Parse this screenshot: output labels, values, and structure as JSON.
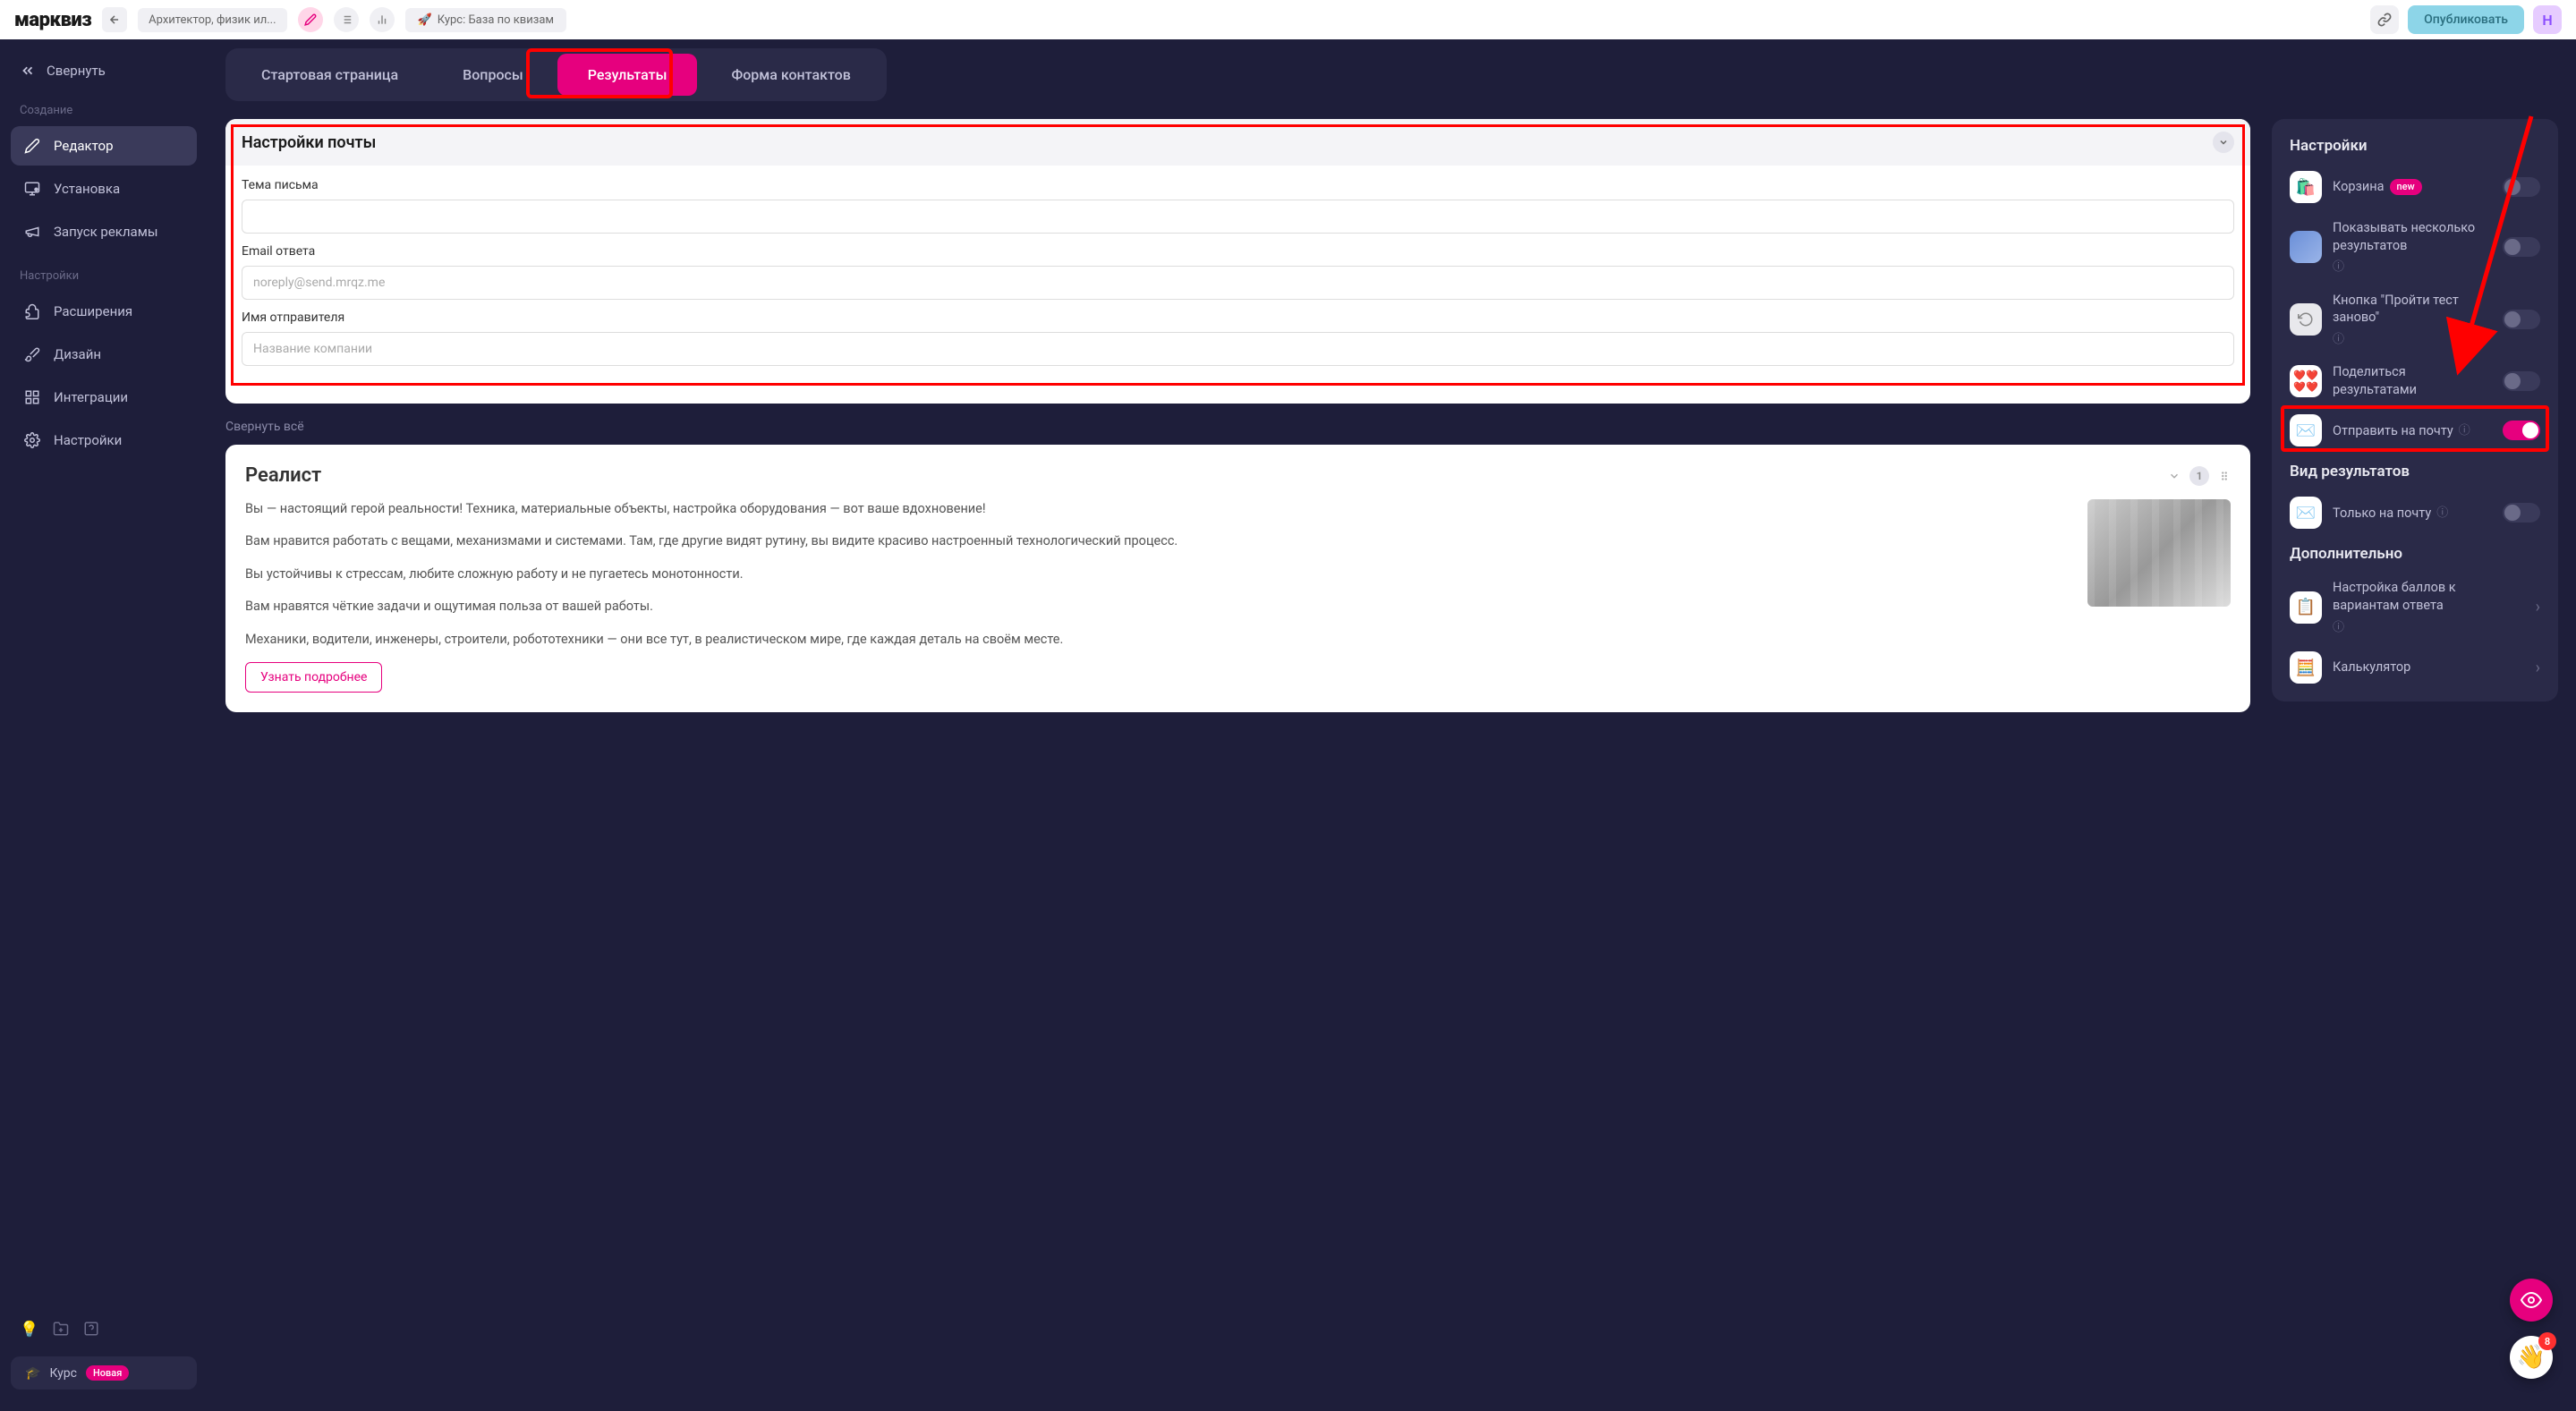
{
  "topbar": {
    "logo": "марквиз",
    "quiz_name": "Архитектор, физик ил...",
    "course_pill": "Курс: База по квизам",
    "publish": "Опубликовать",
    "avatar_letter": "Н"
  },
  "sidebar": {
    "collapse": "Свернуть",
    "section_create": "Создание",
    "editor": "Редактор",
    "install": "Установка",
    "ads": "Запуск рекламы",
    "section_settings": "Настройки",
    "extensions": "Расширения",
    "design": "Дизайн",
    "integrations": "Интеграции",
    "settings": "Настройки",
    "course": "Курс",
    "new_badge": "Новая"
  },
  "tabs": {
    "start": "Стартовая страница",
    "questions": "Вопросы",
    "results": "Результаты",
    "contacts": "Форма контактов"
  },
  "email": {
    "title": "Настройки почты",
    "subject_label": "Тема письма",
    "subject_value": "",
    "reply_label": "Email ответа",
    "reply_placeholder": "noreply@send.mrqz.me",
    "reply_value": "",
    "sender_label": "Имя отправителя",
    "sender_placeholder": "Название компании",
    "sender_value": ""
  },
  "collapse_all": "Свернуть всё",
  "result": {
    "title": "Реалист",
    "number": "1",
    "p1": "Вы — настоящий герой реальности! Техника, материальные объекты, настройка оборудования — вот ваше вдохновение!",
    "p2": "Вам нравится работать с вещами, механизмами и системами. Там, где другие видят рутину, вы видите красиво настроенный технологический процесс.",
    "p3": "Вы устойчивы к стрессам, любите сложную работу и не пугаетесь монотонности.",
    "p4": "Вам нравятся чёткие задачи и ощутимая польза от вашей работы.",
    "p5": "Механики, водители, инженеры, строители, робототехники — они все тут, в реалистическом мире, где каждая деталь на своём месте.",
    "learn_more": "Узнать подробнее"
  },
  "settings": {
    "title": "Настройки",
    "cart": "Корзина",
    "new_badge": "new",
    "multiple_results": "Показывать несколько результатов",
    "retry_button": "Кнопка \"Пройти тест заново\"",
    "share": "Поделиться результатами",
    "send_email": "Отправить на почту",
    "view_title": "Вид результатов",
    "email_only": "Только на почту",
    "additional_title": "Дополнительно",
    "scores": "Настройка баллов к вариантам ответа",
    "calculator": "Калькулятор"
  },
  "fab": {
    "badge_count": "8"
  }
}
